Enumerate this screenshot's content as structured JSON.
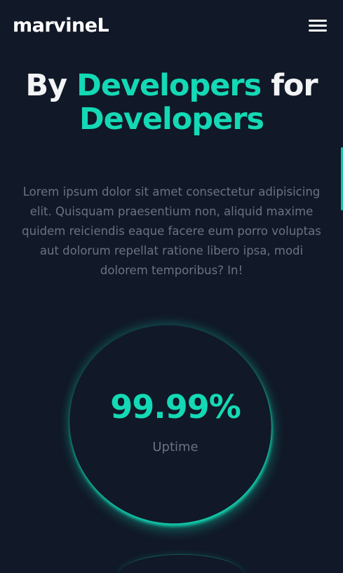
{
  "header": {
    "logo": "marvineL",
    "menu_icon": "hamburger-menu-icon"
  },
  "hero": {
    "title_part1": "By",
    "title_accent1": "Developers",
    "title_part2": "for",
    "title_accent2": "Developers",
    "description": "Lorem ipsum dolor sit amet consectetur adipisicing elit. Quisquam praesentium non, aliquid maxime quidem reiciendis eaque facere eum porro voluptas aut dolorum repellat ratione libero ipsa, modi dolorem temporibus? In!"
  },
  "stats": [
    {
      "value": "99.99%",
      "label": "Uptime"
    }
  ],
  "colors": {
    "background": "#111827",
    "accent": "#14d9b5",
    "text": "#ffffff",
    "muted": "#6b7280"
  }
}
